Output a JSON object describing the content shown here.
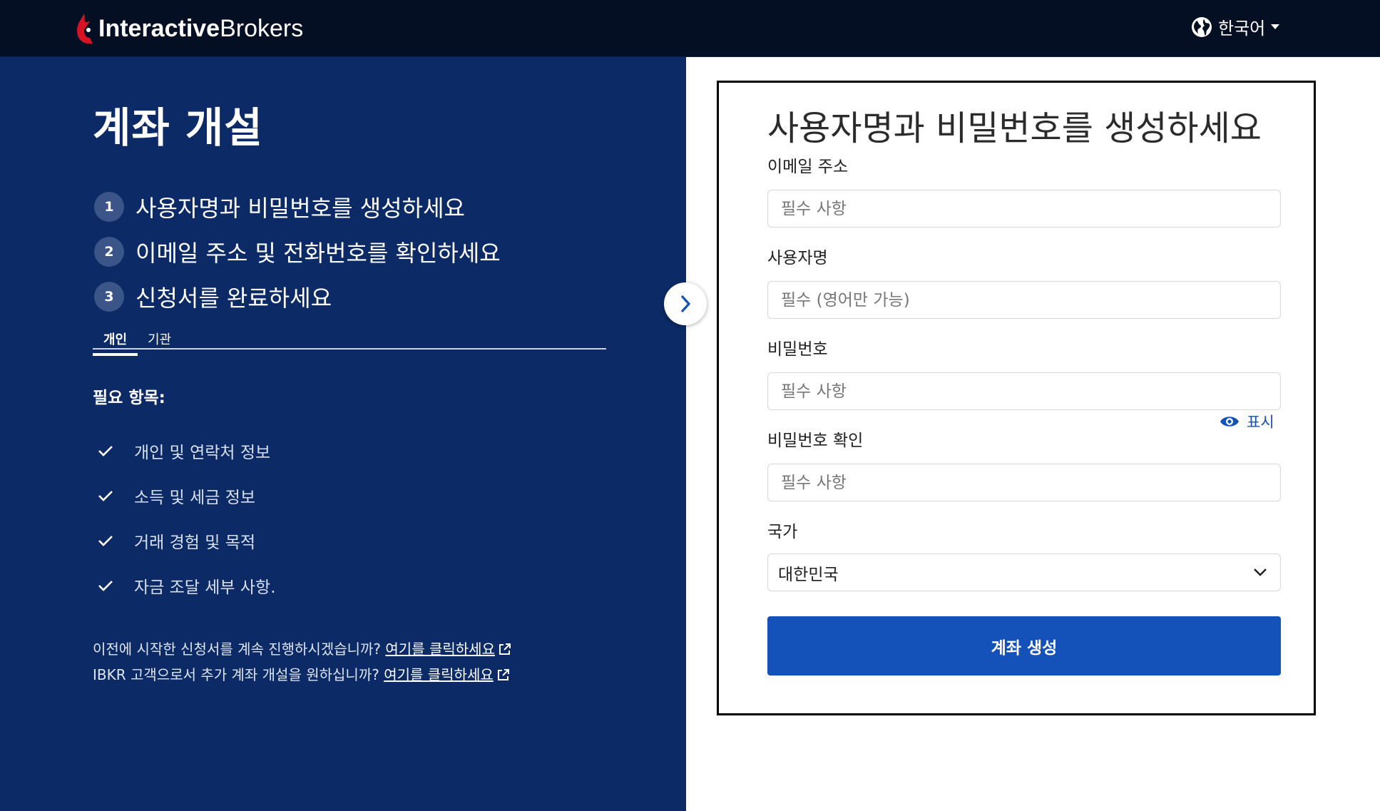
{
  "header": {
    "logo_bold": "Interactive",
    "logo_light": "Brokers",
    "language": "한국어"
  },
  "left": {
    "title": "계좌 개설",
    "steps": [
      {
        "num": "1",
        "label": "사용자명과 비밀번호를 생성하세요"
      },
      {
        "num": "2",
        "label": "이메일 주소 및 전화번호를 확인하세요"
      },
      {
        "num": "3",
        "label": "신청서를 완료하세요"
      }
    ],
    "tabs": [
      "개인",
      "기관"
    ],
    "active_tab": "개인",
    "requirements_title": "필요 항목:",
    "requirements": [
      "개인 및 연락처 정보",
      "소득 및 세금 정보",
      "거래 경험 및 목적",
      "자금 조달 세부 사항."
    ],
    "resume_text": "이전에 시작한 신청서를 계속 진행하시겠습니까?",
    "resume_link": "여기를 클릭하세요",
    "existing_text": "IBKR 고객으로서 추가 계좌 개설을 원하십니까?",
    "existing_link": "여기를 클릭하세요"
  },
  "form": {
    "title": "사용자명과 비밀번호를 생성하세요",
    "email_label": "이메일 주소",
    "email_placeholder": "필수 사항",
    "username_label": "사용자명",
    "username_placeholder": "필수 (영어만 가능)",
    "password_label": "비밀번호",
    "password_placeholder": "필수 사항",
    "show_label": "표시",
    "confirm_label": "비밀번호 확인",
    "confirm_placeholder": "필수 사항",
    "country_label": "국가",
    "country_value": "대한민국",
    "submit_label": "계좌 생성"
  },
  "colors": {
    "header_bg": "#050f24",
    "left_bg": "#0b2a66",
    "accent": "#1451b8",
    "logo_red": "#d81222"
  }
}
